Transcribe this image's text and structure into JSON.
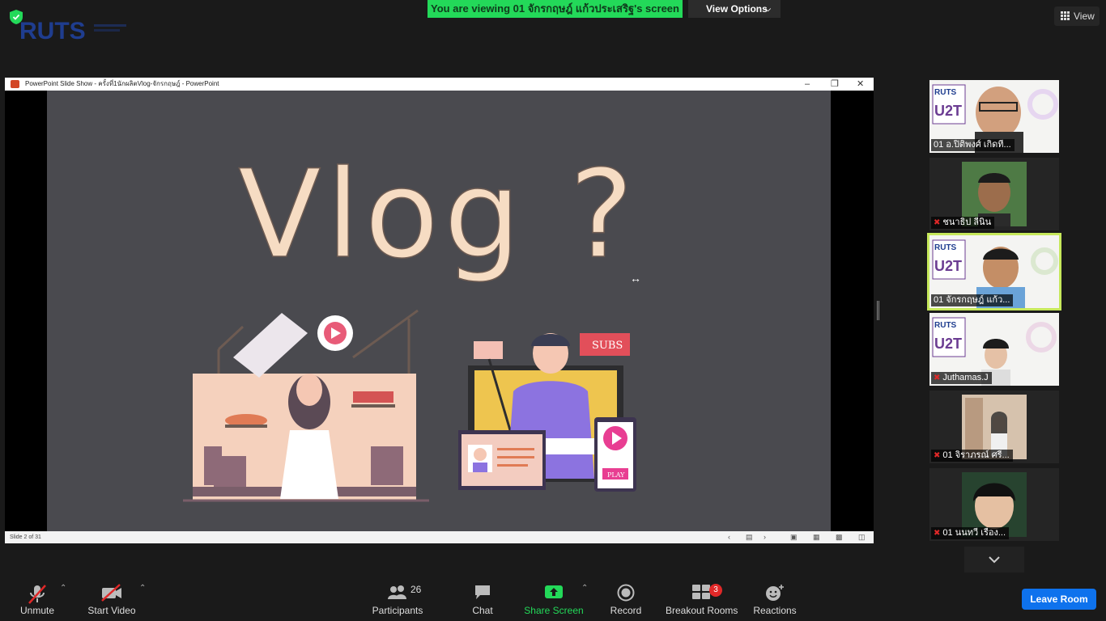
{
  "banner": {
    "viewing": "You are viewing 01 จักรกฤษฎ์ แก้วประเสริฐ's screen",
    "view_options": "View Options"
  },
  "top_right": {
    "view": "View"
  },
  "logo": {
    "text": "RUTS"
  },
  "ppt": {
    "title": "PowerPoint Slide Show  -  ครั้งที่1นักผลิตVlog-จักรกฤษฎ์ - PowerPoint",
    "status": "Slide 2 of 31",
    "slide": {
      "heading": "Vlog ?",
      "subs": "SUBS",
      "play": "PLAY"
    }
  },
  "participants": [
    {
      "name": "01 อ.ปิติพงศ์ เกิดที่...",
      "muted": false,
      "active": false
    },
    {
      "name": "ชนาธิป ลีนิน",
      "muted": true,
      "active": false
    },
    {
      "name": "01 จักรกฤษฎ์ แก้ว...",
      "muted": false,
      "active": true
    },
    {
      "name": "Juthamas.J",
      "muted": true,
      "active": false
    },
    {
      "name": "01 จิราภรณ์ ศรี...",
      "muted": true,
      "active": false
    },
    {
      "name": "01 นนทวี เรือง...",
      "muted": true,
      "active": false
    }
  ],
  "toolbar": {
    "unmute": "Unmute",
    "start_video": "Start Video",
    "participants": "Participants",
    "participants_count": "26",
    "chat": "Chat",
    "share_screen": "Share Screen",
    "record": "Record",
    "breakout_rooms": "Breakout Rooms",
    "breakout_badge": "3",
    "reactions": "Reactions",
    "leave": "Leave Room"
  },
  "colors": {
    "share_green": "#23d959",
    "leave_blue": "#0e72ed",
    "active_outline": "#c6e85b",
    "slide_bg": "#4a4a4f"
  }
}
